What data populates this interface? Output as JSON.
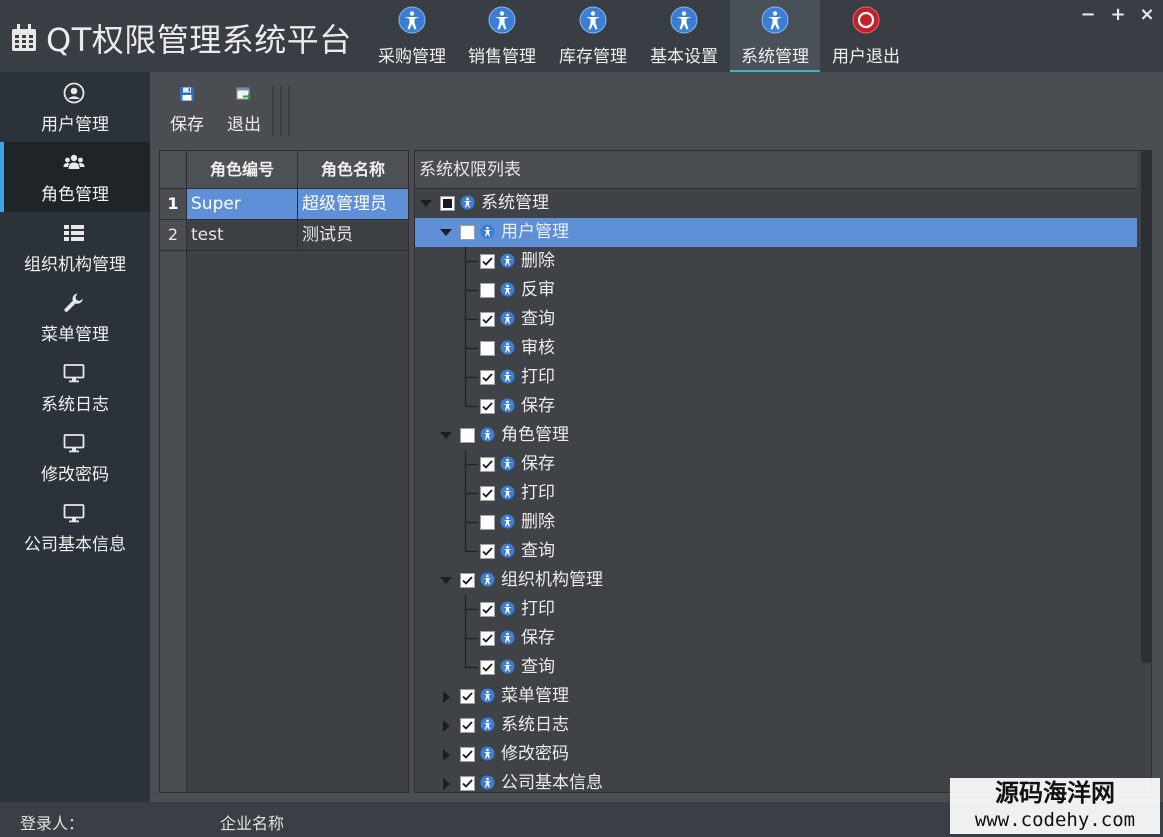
{
  "app": {
    "title": "QT权限管理系统平台"
  },
  "nav_tabs": [
    {
      "label": "采购管理",
      "icon": "accessibility-icon"
    },
    {
      "label": "销售管理",
      "icon": "accessibility-icon"
    },
    {
      "label": "库存管理",
      "icon": "accessibility-icon"
    },
    {
      "label": "基本设置",
      "icon": "accessibility-icon"
    },
    {
      "label": "系统管理",
      "icon": "accessibility-icon",
      "active": true
    },
    {
      "label": "用户退出",
      "icon": "power-icon"
    }
  ],
  "window_controls": {
    "minimize": "−",
    "maximize": "+",
    "close": "×"
  },
  "sidebar": {
    "items": [
      {
        "label": "用户管理",
        "icon": "user-circle-icon"
      },
      {
        "label": "角色管理",
        "icon": "users-icon",
        "active": true
      },
      {
        "label": "组织机构管理",
        "icon": "list-icon"
      },
      {
        "label": "菜单管理",
        "icon": "wrench-icon"
      },
      {
        "label": "系统日志",
        "icon": "monitor-icon"
      },
      {
        "label": "修改密码",
        "icon": "monitor-icon"
      },
      {
        "label": "公司基本信息",
        "icon": "monitor-icon"
      }
    ]
  },
  "toolbar": {
    "save_label": "保存",
    "exit_label": "退出"
  },
  "role_table": {
    "headers": [
      "角色编号",
      "角色名称"
    ],
    "rows": [
      {
        "num": "1",
        "code": "Super",
        "name": "超级管理员",
        "selected": true
      },
      {
        "num": "2",
        "code": "test",
        "name": "测试员"
      }
    ]
  },
  "permission_tree": {
    "header": "系统权限列表",
    "nodes": [
      {
        "label": "系统管理",
        "level": 0,
        "state": "partial",
        "expander": "expanded"
      },
      {
        "label": "用户管理",
        "level": 1,
        "state": "unchecked",
        "expander": "expanded",
        "selected": true
      },
      {
        "label": "删除",
        "level": 2,
        "state": "checked"
      },
      {
        "label": "反审",
        "level": 2,
        "state": "unchecked"
      },
      {
        "label": "查询",
        "level": 2,
        "state": "checked"
      },
      {
        "label": "审核",
        "level": 2,
        "state": "unchecked"
      },
      {
        "label": "打印",
        "level": 2,
        "state": "checked"
      },
      {
        "label": "保存",
        "level": 2,
        "state": "checked"
      },
      {
        "label": "角色管理",
        "level": 1,
        "state": "unchecked",
        "expander": "expanded"
      },
      {
        "label": "保存",
        "level": 2,
        "state": "checked"
      },
      {
        "label": "打印",
        "level": 2,
        "state": "checked"
      },
      {
        "label": "删除",
        "level": 2,
        "state": "unchecked"
      },
      {
        "label": "查询",
        "level": 2,
        "state": "checked"
      },
      {
        "label": "组织机构管理",
        "level": 1,
        "state": "checked",
        "expander": "expanded"
      },
      {
        "label": "打印",
        "level": 2,
        "state": "checked"
      },
      {
        "label": "保存",
        "level": 2,
        "state": "checked"
      },
      {
        "label": "查询",
        "level": 2,
        "state": "checked"
      },
      {
        "label": "菜单管理",
        "level": 1,
        "state": "checked",
        "expander": "collapsed"
      },
      {
        "label": "系统日志",
        "level": 1,
        "state": "checked",
        "expander": "collapsed"
      },
      {
        "label": "修改密码",
        "level": 1,
        "state": "checked",
        "expander": "collapsed"
      },
      {
        "label": "公司基本信息",
        "level": 1,
        "state": "checked",
        "expander": "collapsed"
      }
    ]
  },
  "statusbar": {
    "login_label": "登录人：",
    "company_label": "企业名称"
  },
  "watermark": {
    "line1": "源码海洋网",
    "line2": "www.codehy.com"
  },
  "colors": {
    "accent": "#3fb0c8",
    "selection": "#5e8fd7",
    "sidebar_active": "#3ea6e6"
  }
}
